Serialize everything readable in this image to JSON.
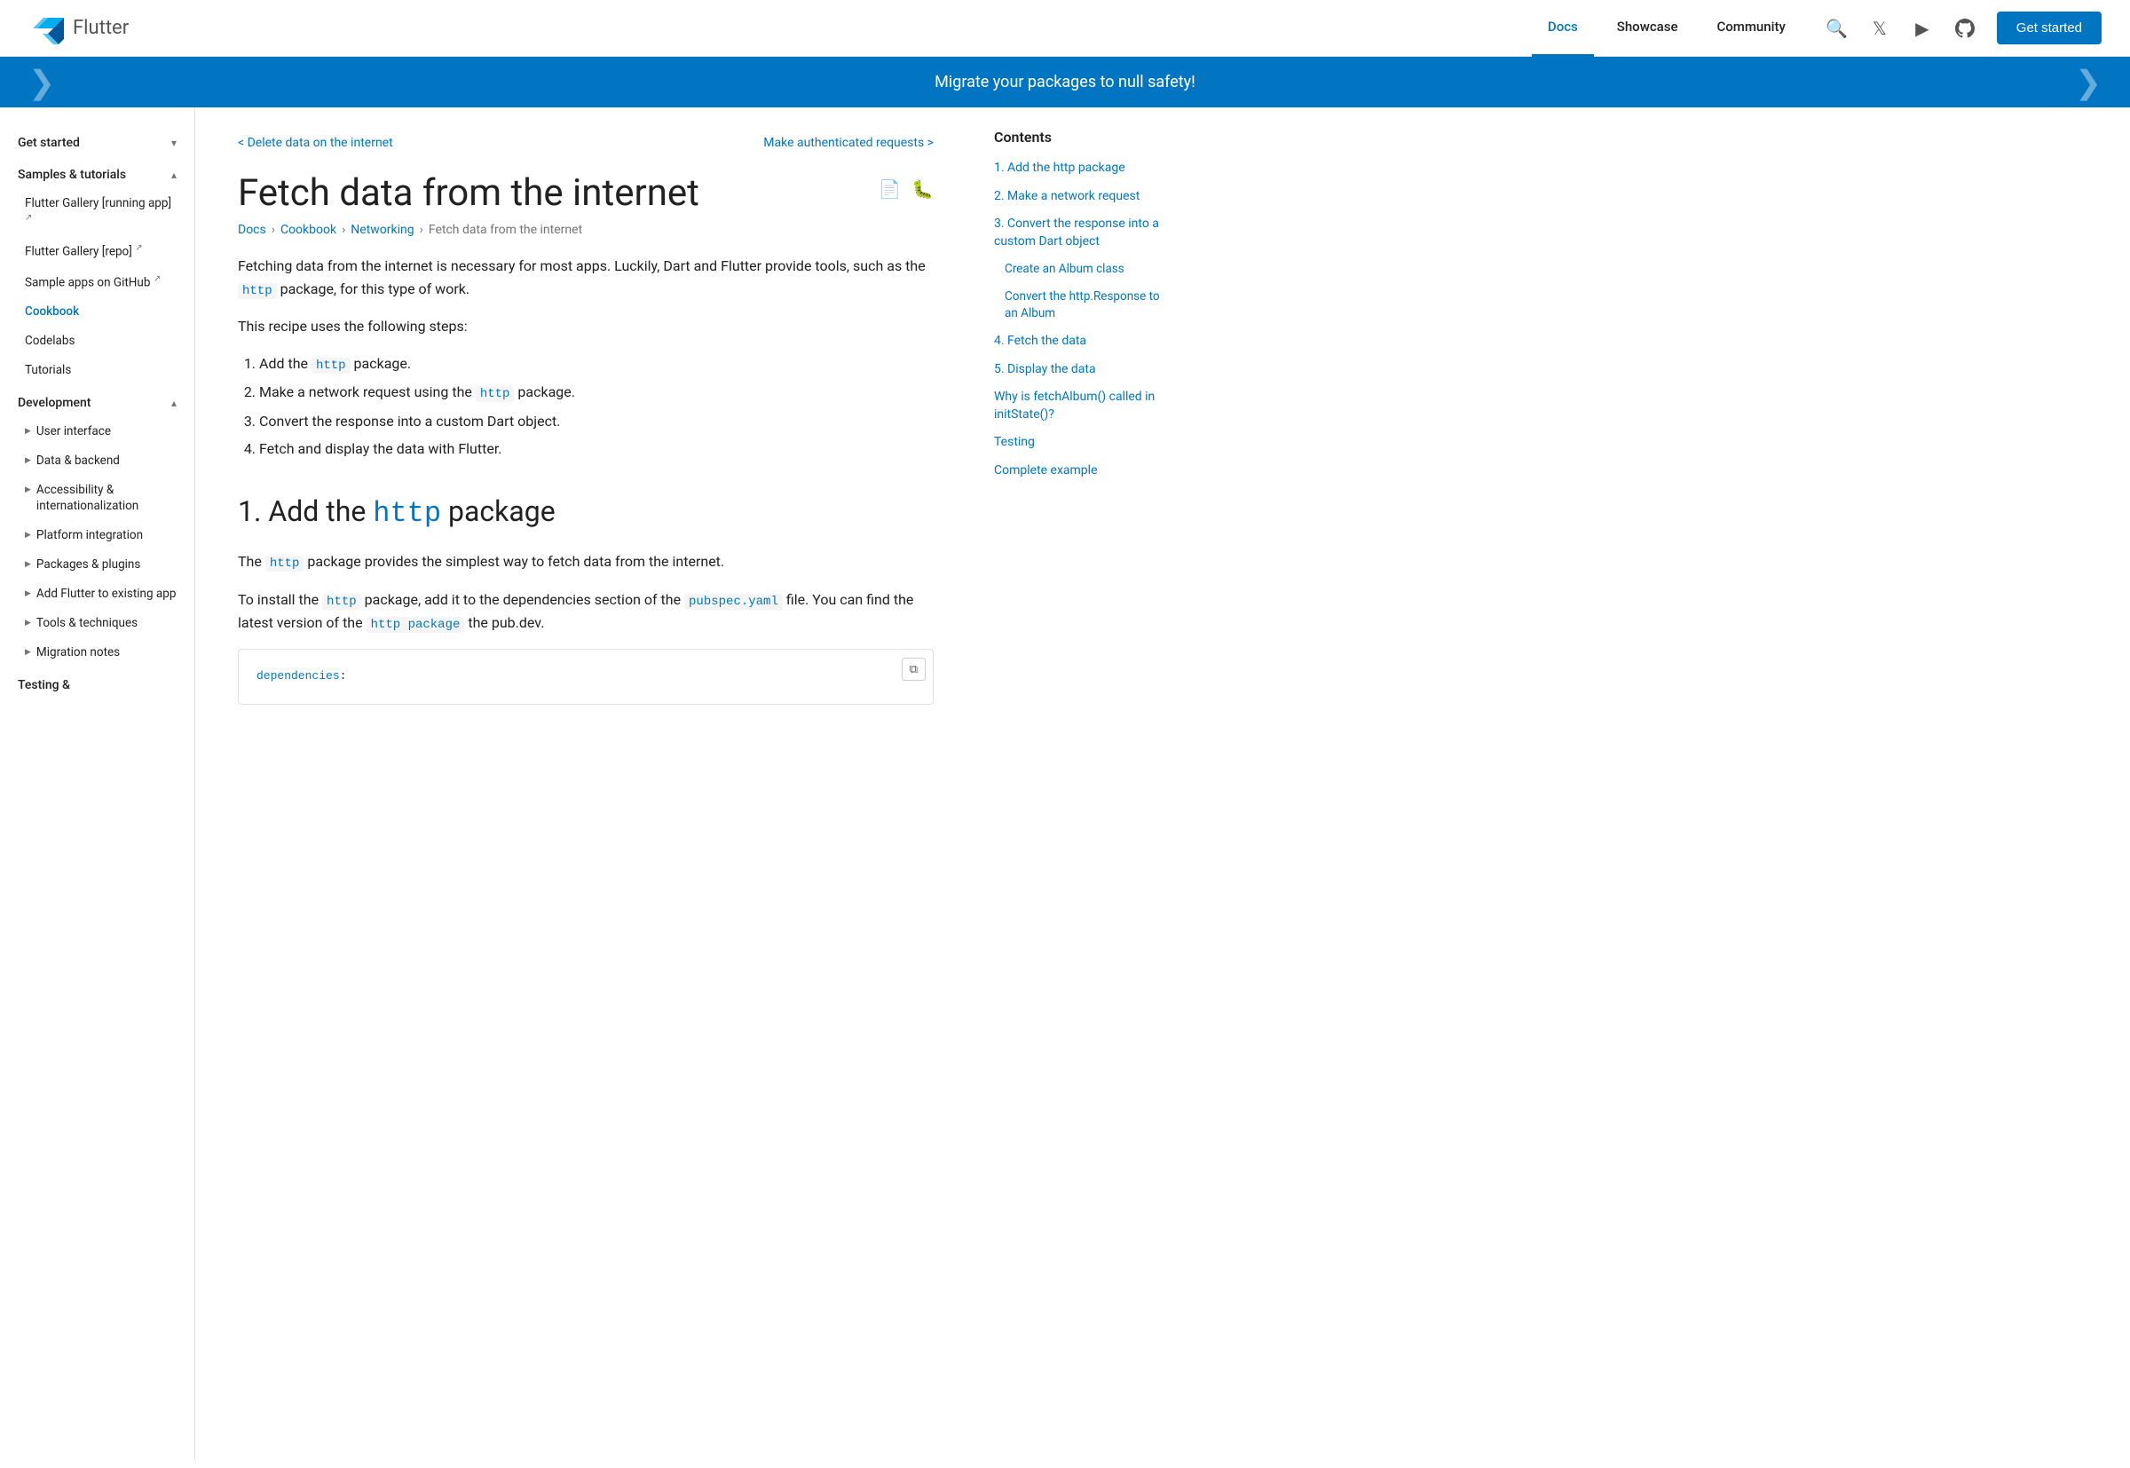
{
  "header": {
    "logo_text": "Flutter",
    "nav": [
      {
        "id": "docs",
        "label": "Docs",
        "active": true
      },
      {
        "id": "showcase",
        "label": "Showcase",
        "active": false
      },
      {
        "id": "community",
        "label": "Community",
        "active": false
      }
    ],
    "get_started": "Get started"
  },
  "banner": {
    "text": "Migrate your packages to null safety!"
  },
  "sidebar": {
    "sections": [
      {
        "id": "get-started",
        "label": "Get started",
        "expanded": false,
        "chevron": "expand_more"
      },
      {
        "id": "samples-tutorials",
        "label": "Samples & tutorials",
        "expanded": true,
        "items": [
          {
            "id": "flutter-gallery-running",
            "label": "Flutter Gallery [running app]",
            "external": true
          },
          {
            "id": "flutter-gallery-repo",
            "label": "Flutter Gallery [repo]",
            "external": true
          },
          {
            "id": "sample-apps",
            "label": "Sample apps on GitHub",
            "external": true
          },
          {
            "id": "cookbook",
            "label": "Cookbook",
            "active": true
          },
          {
            "id": "codelabs",
            "label": "Codelabs"
          },
          {
            "id": "tutorials",
            "label": "Tutorials"
          }
        ]
      },
      {
        "id": "development",
        "label": "Development",
        "expanded": true,
        "items": [
          {
            "id": "user-interface",
            "label": "User interface",
            "arrow": true
          },
          {
            "id": "data-backend",
            "label": "Data & backend",
            "arrow": true
          },
          {
            "id": "accessibility",
            "label": "Accessibility & internationalization",
            "arrow": true
          },
          {
            "id": "platform-integration",
            "label": "Platform integration",
            "arrow": true
          },
          {
            "id": "packages-plugins",
            "label": "Packages & plugins",
            "arrow": true
          },
          {
            "id": "add-flutter",
            "label": "Add Flutter to existing app",
            "arrow": true
          },
          {
            "id": "tools-techniques",
            "label": "Tools & techniques",
            "arrow": true
          },
          {
            "id": "migration-notes",
            "label": "Migration notes",
            "arrow": true
          }
        ]
      },
      {
        "id": "testing",
        "label": "Testing &",
        "expanded": false
      }
    ]
  },
  "page_nav": {
    "prev": "< Delete data on the internet",
    "next": "Make authenticated requests >"
  },
  "page": {
    "title": "Fetch data from the internet",
    "breadcrumb": [
      "Docs",
      "Cookbook",
      "Networking",
      "Fetch data from the internet"
    ],
    "intro": "Fetching data from the internet is necessary for most apps. Luckily, Dart and Flutter provide tools, such as the http package, for this type of work.",
    "steps_intro": "This recipe uses the following steps:",
    "steps": [
      "Add the http package.",
      "Make a network request using the http package.",
      "Convert the response into a custom Dart object.",
      "Fetch and display the data with Flutter."
    ],
    "section1_heading_prefix": "1. Add the ",
    "section1_heading_code": "http",
    "section1_heading_suffix": " package",
    "section1_p1_prefix": "The ",
    "section1_p1_code": "http",
    "section1_p1_suffix": " package provides the simplest way to fetch data from the internet.",
    "section1_p2_prefix": "To install the ",
    "section1_p2_code1": "http",
    "section1_p2_mid": " package, add it to the dependencies section of the ",
    "section1_p2_code2": "pubspec.yaml",
    "section1_p2_suffix": " file. You can find the latest version of the ",
    "section1_p2_code3": "http package",
    "section1_p2_end": " the pub.dev.",
    "code_block_key": "dependencies",
    "copy_label": "copy"
  },
  "toc": {
    "title": "Contents",
    "items": [
      {
        "id": "add-http",
        "label": "1. Add the http package",
        "sub": false
      },
      {
        "id": "network-request",
        "label": "2. Make a network request",
        "sub": false
      },
      {
        "id": "convert-response",
        "label": "3. Convert the response into a custom Dart object",
        "sub": false
      },
      {
        "id": "create-album",
        "label": "Create an Album class",
        "sub": true
      },
      {
        "id": "convert-album",
        "label": "Convert the http.Response to an Album",
        "sub": true
      },
      {
        "id": "fetch-data",
        "label": "4. Fetch the data",
        "sub": false
      },
      {
        "id": "display-data",
        "label": "5. Display the data",
        "sub": false
      },
      {
        "id": "why-fetch",
        "label": "Why is fetchAlbum() called in initState()?",
        "sub": false
      },
      {
        "id": "testing",
        "label": "Testing",
        "sub": false
      },
      {
        "id": "complete",
        "label": "Complete example",
        "sub": false
      }
    ]
  }
}
